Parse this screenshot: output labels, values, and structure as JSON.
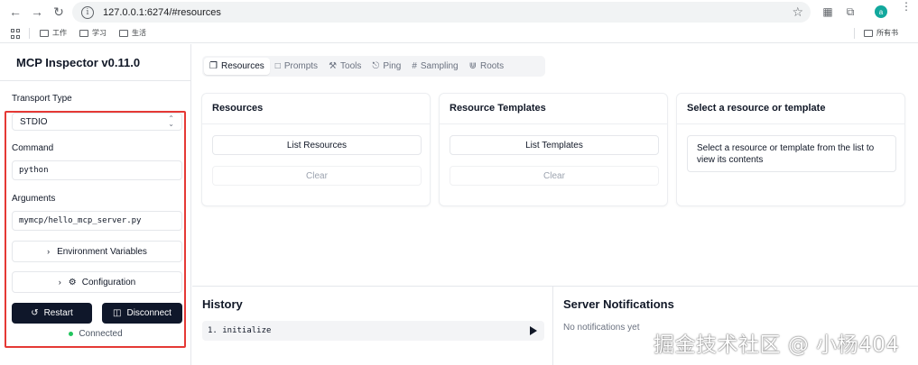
{
  "browser": {
    "url": "127.0.0.1:6274/#resources",
    "bookmarks": [
      "工作",
      "学习",
      "生活"
    ],
    "bookmarks_right": "所有书",
    "profile_initial": "a",
    "icons": {
      "back": "arrow-left-icon",
      "forward": "arrow-right-icon",
      "reload": "reload-icon",
      "info": "info-icon",
      "star": "star-icon",
      "qr": "qr-icon",
      "extensions": "puzzle-icon"
    }
  },
  "sidebar": {
    "title": "MCP Inspector v0.11.0",
    "transport_label": "Transport Type",
    "transport_value": "STDIO",
    "command_label": "Command",
    "command_value": "python",
    "arguments_label": "Arguments",
    "arguments_value": "mymcp/hello_mcp_server.py",
    "env_button": "Environment Variables",
    "config_button": "Configuration",
    "restart_button": "Restart",
    "disconnect_button": "Disconnect",
    "status": "Connected",
    "status_color": "#22c55e",
    "highlight_color": "#e53935"
  },
  "tabs": [
    {
      "label": "Resources",
      "icon": "resources-icon",
      "active": true
    },
    {
      "label": "Prompts",
      "icon": "prompts-icon",
      "active": false
    },
    {
      "label": "Tools",
      "icon": "tools-icon",
      "active": false
    },
    {
      "label": "Ping",
      "icon": "bell-icon",
      "active": false
    },
    {
      "label": "Sampling",
      "icon": "hash-icon",
      "active": false
    },
    {
      "label": "Roots",
      "icon": "roots-icon",
      "active": false
    }
  ],
  "resources_card": {
    "title": "Resources",
    "list_button": "List Resources",
    "clear_button": "Clear"
  },
  "templates_card": {
    "title": "Resource Templates",
    "list_button": "List Templates",
    "clear_button": "Clear"
  },
  "detail_card": {
    "title": "Select a resource or template",
    "hint": "Select a resource or template from the list to view its contents"
  },
  "history": {
    "title": "History",
    "items": [
      "1. initialize"
    ]
  },
  "notifications": {
    "title": "Server Notifications",
    "empty_text": "No notifications yet"
  },
  "watermark": "掘金技术社区 @ 小杨404",
  "accent_dark": "#0f172a"
}
